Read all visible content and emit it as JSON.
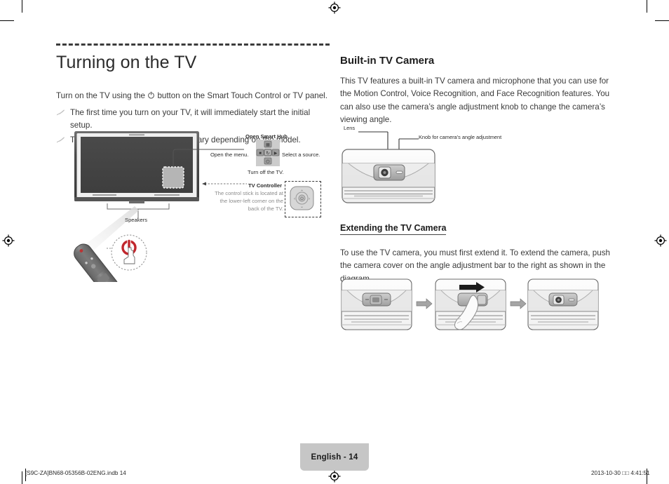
{
  "page": {
    "title": "Turning on the TV",
    "badge": "English - 14",
    "footer_left": "[S9C-ZA]BN68-05356B-02ENG.indb   14",
    "footer_right": "2013-10-30   □□ 4:41:51"
  },
  "left": {
    "intro_before": "Turn on the TV using the",
    "intro_after": "button on the Smart Touch Control or TV panel.",
    "notes": [
      "The first time you turn on your TV, it will immediately start the initial setup.",
      "The product color and shape may vary depending on the model."
    ],
    "callouts": {
      "open_smart_hub": "Open Smart Hub.",
      "open_the_menu": "Open the menu.",
      "select_a_source": "Select a source.",
      "turn_off_the_tv": "Turn off the TV.",
      "tv_controller": "TV Controller",
      "tv_controller_desc": "The control stick is located at the lower-left corner on the back of the TV.",
      "speakers": "Speakers"
    }
  },
  "right": {
    "section_title": "Built-in TV Camera",
    "section_body": "This TV features a built-in TV camera and microphone that you can use for the Motion Control, Voice Recognition, and Face Recognition features. You can also use the camera’s angle adjustment knob to change the camera’s viewing angle.",
    "cam_labels": {
      "lens": "Lens",
      "knob": "Knob for camera’s angle adjustment"
    },
    "sub_title": "Extending the TV Camera",
    "sub_body": "To use the TV camera, you must first extend it. To extend the camera, push the camera cover on the angle adjustment bar to the right as shown in the diagram."
  },
  "colors": {
    "accent_red": "#c1272d",
    "badge_gray": "#c6c6c6",
    "text": "#3a3a3a",
    "rule": "#3b3b3b"
  },
  "icons": {
    "note": "pencil-note-icon",
    "power": "power-icon",
    "registration": "registration-mark-icon",
    "arrow": "arrow-right-icon"
  }
}
